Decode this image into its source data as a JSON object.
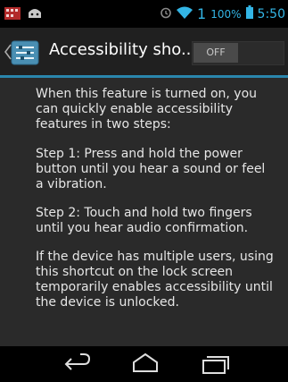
{
  "status_bar": {
    "left_icons": [
      "notification-icon",
      "android-icon"
    ],
    "right_icons": [
      "alarm-icon",
      "wifi-icon"
    ],
    "notification_count": "1",
    "battery_percent": "100%",
    "time": "5:50",
    "accent_color": "#33b5e5"
  },
  "action_bar": {
    "title": "Accessibility sho...",
    "toggle_label": "OFF",
    "toggle_state": "off",
    "divider_color": "#2a86ad"
  },
  "content": {
    "paragraphs": [
      "When this feature is turned on, you can quickly enable accessibility features in two steps:",
      "Step 1: Press and hold the power button until you hear a sound or feel a vibration.",
      "Step 2: Touch and hold two fingers until you hear audio confirmation.",
      "If the device has multiple users, using this shortcut on the lock screen temporarily enables accessibility until the device is unlocked."
    ]
  },
  "nav_bar": {
    "buttons": [
      "back-icon",
      "home-icon",
      "recents-icon"
    ]
  }
}
